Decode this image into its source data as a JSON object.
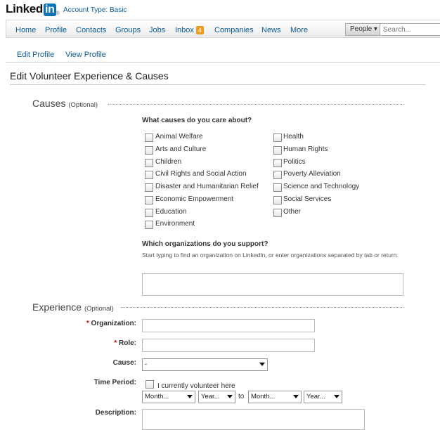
{
  "header": {
    "logo_word": "Linked",
    "logo_in": "in",
    "logo_mark": "®",
    "account_type": "Account Type: Basic"
  },
  "nav": {
    "items": [
      "Home",
      "Profile",
      "Contacts",
      "Groups",
      "Jobs",
      "Inbox",
      "Companies",
      "News",
      "More"
    ],
    "inbox_count": "4",
    "search_scope": "People ▾",
    "search_placeholder": "Search..."
  },
  "subnav": {
    "edit_profile": "Edit Profile",
    "view_profile": "View Profile"
  },
  "page_title": "Edit Volunteer Experience & Causes",
  "causes": {
    "heading": "Causes",
    "optional": "(Optional)",
    "question": "What causes do you care about?",
    "left_column": [
      "Animal Welfare",
      "Arts and Culture",
      "Children",
      "Civil Rights and Social Action",
      "Disaster and Humanitarian Relief",
      "Economic Empowerment",
      "Education",
      "Environment"
    ],
    "right_column": [
      "Health",
      "Human Rights",
      "Politics",
      "Poverty Alleviation",
      "Science and Technology",
      "Social Services",
      "Other"
    ],
    "org_question": "Which organizations do you support?",
    "org_help": "Start typing to find an organization on LinkedIn, or enter organizations separated by tab or return.",
    "org_value": ""
  },
  "experience": {
    "heading": "Experience",
    "optional": "(Optional)",
    "organization_label": "Organization:",
    "role_label": "Role:",
    "cause_label": "Cause:",
    "cause_value": "-",
    "time_period_label": "Time Period:",
    "currently_volunteer": "I currently volunteer here",
    "start_month": "Month...",
    "start_year": "Year...",
    "to_text": "to",
    "end_month": "Month...",
    "end_year": "Year...",
    "description_label": "Description:"
  },
  "colors": {
    "link": "#0a5a9a",
    "logo_blue": "#0a72b6",
    "badge": "#f39b1d",
    "required": "#cc0000"
  }
}
